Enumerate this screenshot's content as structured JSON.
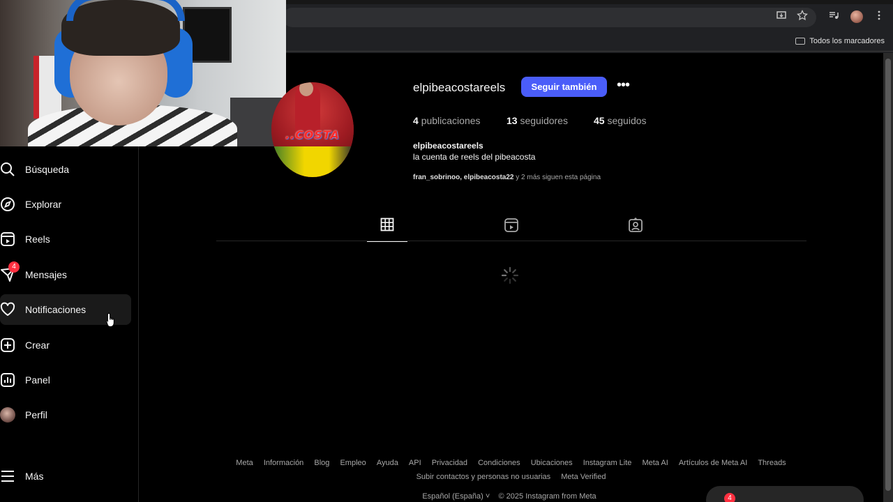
{
  "browser": {
    "bookmarks_folder_label": "Todos los marcadores"
  },
  "sidebar": {
    "items": [
      {
        "label": "Búsqueda",
        "icon": "search-icon"
      },
      {
        "label": "Explorar",
        "icon": "explore-icon"
      },
      {
        "label": "Reels",
        "icon": "reels-icon"
      },
      {
        "label": "Mensajes",
        "icon": "messages-icon",
        "badge": "4"
      },
      {
        "label": "Notificaciones",
        "icon": "heart-icon"
      },
      {
        "label": "Crear",
        "icon": "create-icon"
      },
      {
        "label": "Panel",
        "icon": "panel-icon"
      },
      {
        "label": "Perfil",
        "icon": "profile-avatar"
      },
      {
        "label": "Más",
        "icon": "menu-icon"
      }
    ]
  },
  "profile": {
    "username": "elpibeacostareels",
    "follow_label": "Seguir también",
    "more_label": "•••",
    "stats": {
      "posts_count": "4",
      "posts_label": "publicaciones",
      "followers_count": "13",
      "followers_label": "seguidores",
      "following_count": "45",
      "following_label": "seguidos"
    },
    "bio_name": "elpibeacostareels",
    "bio_text": "la cuenta de reels del pibeacosta",
    "followed_by_names": "fran_sobrinoo, elpibeacosta22",
    "followed_by_rest": " y 2 más siguen esta página",
    "picture_text": "..COSTA"
  },
  "tabs": [
    {
      "name": "posts",
      "icon": "grid-icon",
      "active": true
    },
    {
      "name": "reels",
      "icon": "reels-icon",
      "active": false
    },
    {
      "name": "tagged",
      "icon": "tagged-icon",
      "active": false
    }
  ],
  "footer": {
    "links": [
      "Meta",
      "Información",
      "Blog",
      "Empleo",
      "Ayuda",
      "API",
      "Privacidad",
      "Condiciones",
      "Ubicaciones",
      "Instagram Lite",
      "Meta AI",
      "Artículos de Meta AI",
      "Threads",
      "Subir contactos y personas no usuarias",
      "Meta Verified"
    ],
    "language": "Español (España)",
    "copyright": "© 2025 Instagram from Meta"
  },
  "messages_pill": {
    "badge": "4"
  },
  "colors": {
    "accent": "#4a5df9",
    "badge": "#ff3040",
    "background": "#000000"
  }
}
